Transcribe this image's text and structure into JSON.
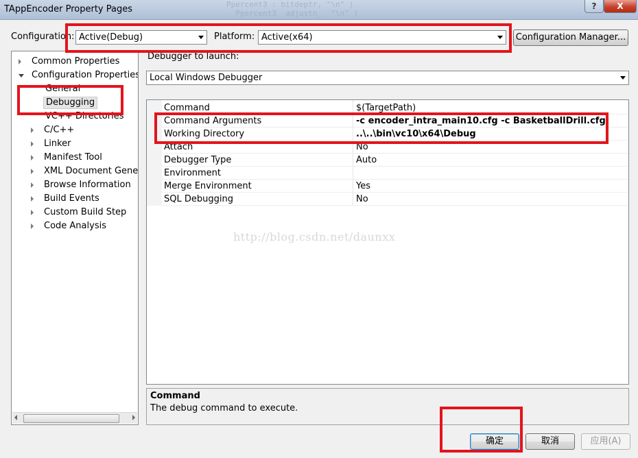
{
  "window": {
    "title": "TAppEncoder Property Pages",
    "help_glyph": "?",
    "close_glyph": "X",
    "background_code": "Ppercent3 : bitdeptr, \"\\n\" )\n  Ppercent3  adjustn_  \"\\n\" )"
  },
  "config": {
    "configuration_label": "Configuration:",
    "configuration_value": "Active(Debug)",
    "platform_label": "Platform:",
    "platform_value": "Active(x64)",
    "manager_button": "Configuration Manager..."
  },
  "tree": {
    "items": [
      {
        "label": "Common Properties",
        "expander": "right"
      },
      {
        "label": "Configuration Properties",
        "expander": "down"
      },
      {
        "label": "General",
        "expander": "none"
      },
      {
        "label": "Debugging",
        "expander": "none",
        "selected": true
      },
      {
        "label": "VC++ Directories",
        "expander": "none"
      },
      {
        "label": "C/C++",
        "expander": "right"
      },
      {
        "label": "Linker",
        "expander": "right"
      },
      {
        "label": "Manifest Tool",
        "expander": "right"
      },
      {
        "label": "XML Document Generat",
        "expander": "right"
      },
      {
        "label": "Browse Information",
        "expander": "right"
      },
      {
        "label": "Build Events",
        "expander": "right"
      },
      {
        "label": "Custom Build Step",
        "expander": "right"
      },
      {
        "label": "Code Analysis",
        "expander": "right"
      }
    ]
  },
  "debugger": {
    "launch_label": "Debugger to launch:",
    "launch_value": "Local Windows Debugger"
  },
  "properties": [
    {
      "name": "Command",
      "value": "$(TargetPath)",
      "bold": false
    },
    {
      "name": "Command Arguments",
      "value": "-c encoder_intra_main10.cfg -c BasketballDrill.cfg",
      "bold": true
    },
    {
      "name": "Working Directory",
      "value": "..\\..\\bin\\vc10\\x64\\Debug",
      "bold": true
    },
    {
      "name": "Attach",
      "value": "No",
      "bold": false
    },
    {
      "name": "Debugger Type",
      "value": "Auto",
      "bold": false
    },
    {
      "name": "Environment",
      "value": "",
      "bold": false
    },
    {
      "name": "Merge Environment",
      "value": "Yes",
      "bold": false
    },
    {
      "name": "SQL Debugging",
      "value": "No",
      "bold": false
    }
  ],
  "watermark": "http://blog.csdn.net/daunxx",
  "description": {
    "title": "Command",
    "text": "The debug command to execute."
  },
  "buttons": {
    "ok": "确定",
    "cancel": "取消",
    "apply": "应用(A)"
  },
  "colors": {
    "annotation_red": "#e3141c",
    "selection_bg": "#e5e5e5"
  }
}
